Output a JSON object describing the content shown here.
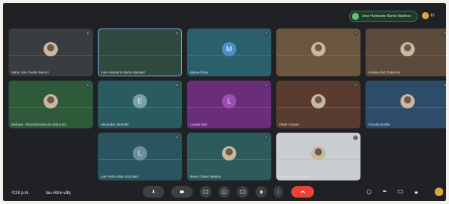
{
  "topbar": {
    "speaker_label": "Jose Humberto Barria Martinez",
    "participants_count": "15"
  },
  "tiles": [
    {
      "name": "Maria Jose Gudino Munoz",
      "type": "video",
      "bg": "#3a3d40"
    },
    {
      "name": "Jose Humberto Barria Martinez",
      "type": "speaking",
      "bg": "#2f4a3f"
    },
    {
      "name": "Manuel Dias",
      "type": "initial",
      "initial": "M",
      "bg": "#2a5f6b",
      "avatar_color": "#4a8fc7"
    },
    {
      "name": "",
      "type": "video",
      "bg": "#6b5640"
    },
    {
      "name": "Andrea Ruiz Gutierrez",
      "type": "photo",
      "bg": "#5c4a3a"
    },
    {
      "name": "Barbara - Reconciliacion de Vida y Sa...",
      "type": "photo",
      "bg": "#2f5a3a"
    },
    {
      "name": "Alexandra Jaramillo",
      "type": "initial",
      "initial": "E",
      "bg": "#2a5b61",
      "avatar_color": "#7aa0a8"
    },
    {
      "name": "Lorena Diaz",
      "type": "initial",
      "initial": "L",
      "bg": "#6a2d7a",
      "avatar_color": "#9c4fb0"
    },
    {
      "name": "Oliver Ceparo",
      "type": "photo",
      "bg": "#5a3b2f"
    },
    {
      "name": "Claudia Bonilla",
      "type": "photo",
      "bg": "#2d4c6a"
    },
    {
      "name": "Luis Pedro Albin Gonzalez",
      "type": "initial",
      "initial": "L",
      "bg": "#2a5560",
      "avatar_color": "#6f8f98"
    },
    {
      "name": "Rene Chavez Medina",
      "type": "photo",
      "bg": "#2d5a5a"
    },
    {
      "name": "Martin Perez Miranda",
      "type": "video",
      "bg": "#c9ccd1"
    }
  ],
  "bottombar": {
    "clock": "4:28 p.m.",
    "meeting_code": "lau-vibre-vdq"
  },
  "colors": {
    "background": "#202124",
    "hangup": "#ea4335",
    "speaking_green": "#5fbf73"
  }
}
